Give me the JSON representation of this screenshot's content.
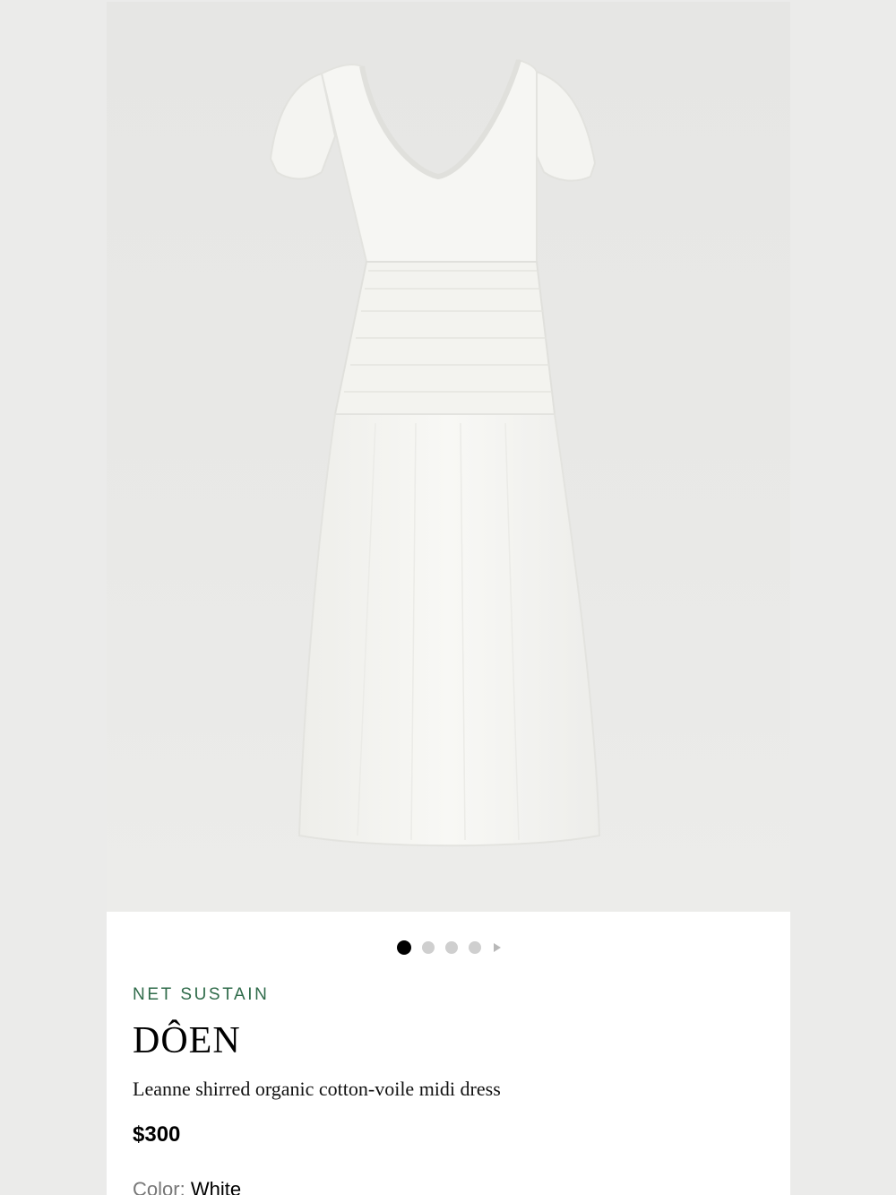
{
  "colors": {
    "page_bg": "#ebebea",
    "card_bg": "#ffffff",
    "sustain_green": "#2f6b4a",
    "dot_active": "#000000",
    "dot_inactive": "#cfcfcf"
  },
  "gallery": {
    "image_icon": "white-midi-dress-photo",
    "dots": [
      "active",
      "inactive",
      "inactive",
      "inactive"
    ],
    "next_icon": "play-triangle-icon"
  },
  "product": {
    "tag": "NET SUSTAIN",
    "brand": "DÔEN",
    "name": "Leanne shirred organic cotton-voile midi dress",
    "price": "$300",
    "color_label": "Color:",
    "color_value": "White"
  }
}
